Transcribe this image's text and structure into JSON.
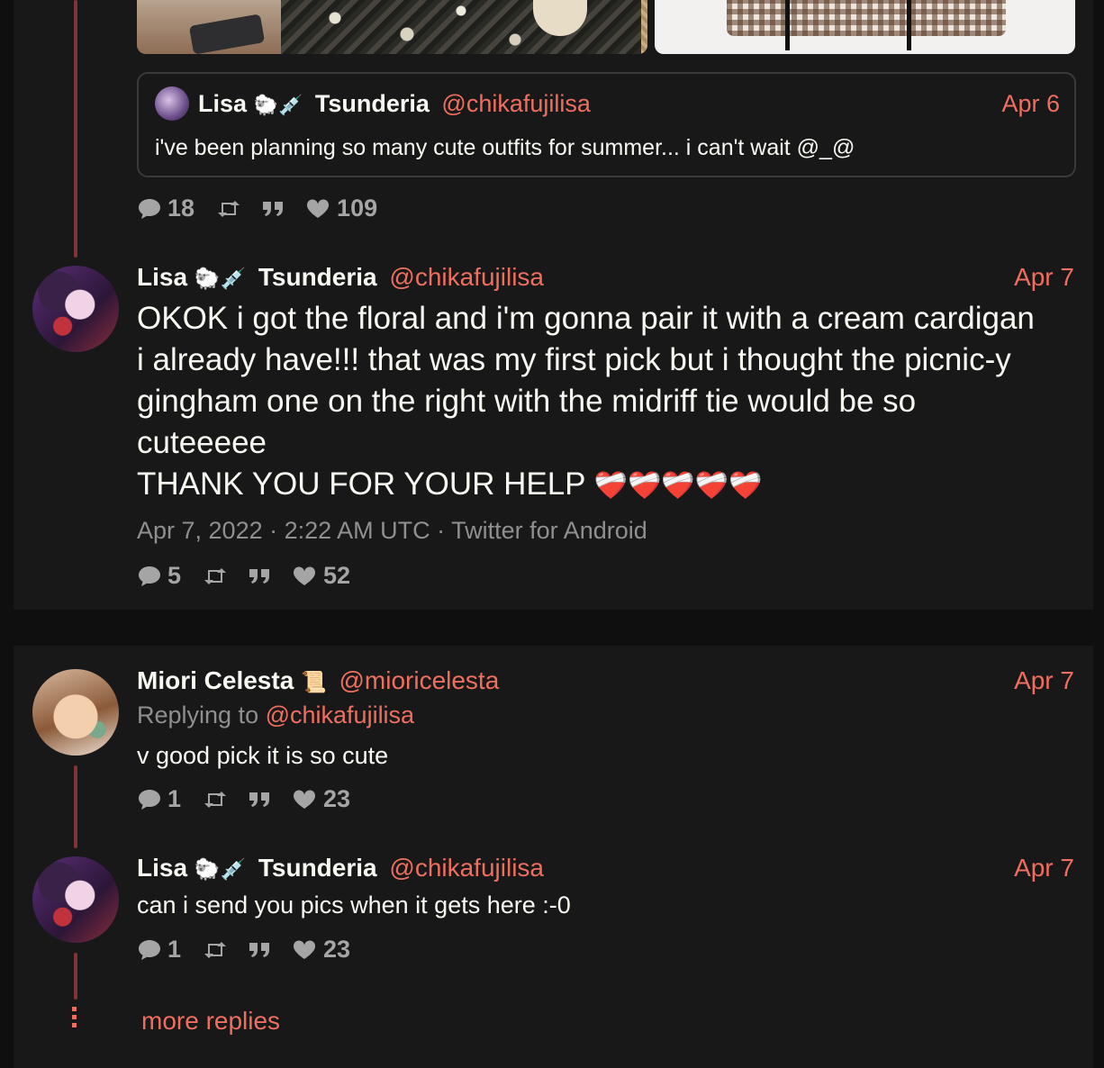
{
  "quoted": {
    "name": "Lisa",
    "name_emoji": "🐑💉",
    "name_suffix": "Tsunderia",
    "handle": "@chikafujilisa",
    "date": "Apr 6",
    "text": "i've been planning so many cute outfits for summer... i can't wait @_@"
  },
  "stats_1": {
    "replies": "18",
    "likes": "109"
  },
  "main_post": {
    "name": "Lisa",
    "name_emoji": "🐑💉",
    "name_suffix": "Tsunderia",
    "handle": "@chikafujilisa",
    "date": "Apr 7",
    "text_line1": "OKOK i got the floral and i'm gonna pair it with a cream cardigan",
    "text_line2": "i already have!!! that was my first pick but i thought the picnic-y",
    "text_line3": "gingham one on the right with the midriff tie would be so",
    "text_line4": "cuteeeee",
    "text_line5": "THANK YOU FOR YOUR HELP",
    "text_line5_emoji": "❤️‍🩹❤️‍🩹❤️‍🩹❤️‍🩹❤️‍🩹",
    "meta": "Apr 7, 2022 · 2:22 AM UTC · Twitter for Android",
    "replies": "5",
    "likes": "52"
  },
  "reply_1": {
    "name": "Miori Celesta",
    "name_emoji": "📜",
    "handle": "@mioricelesta",
    "date": "Apr 7",
    "replying_label": "Replying to",
    "replying_handle": "@chikafujilisa",
    "text": "v good pick it is so cute",
    "replies": "1",
    "likes": "23"
  },
  "reply_2": {
    "name": "Lisa",
    "name_emoji": "🐑💉",
    "name_suffix": "Tsunderia",
    "handle": "@chikafujilisa",
    "date": "Apr 7",
    "text": "can i send you pics when it gets here :-0",
    "replies": "1",
    "likes": "23"
  },
  "more_replies": "more replies",
  "colors": {
    "accent": "#ee6f5f",
    "thread": "#7f3537",
    "panel": "#181818",
    "muted": "#a5a5a5"
  }
}
